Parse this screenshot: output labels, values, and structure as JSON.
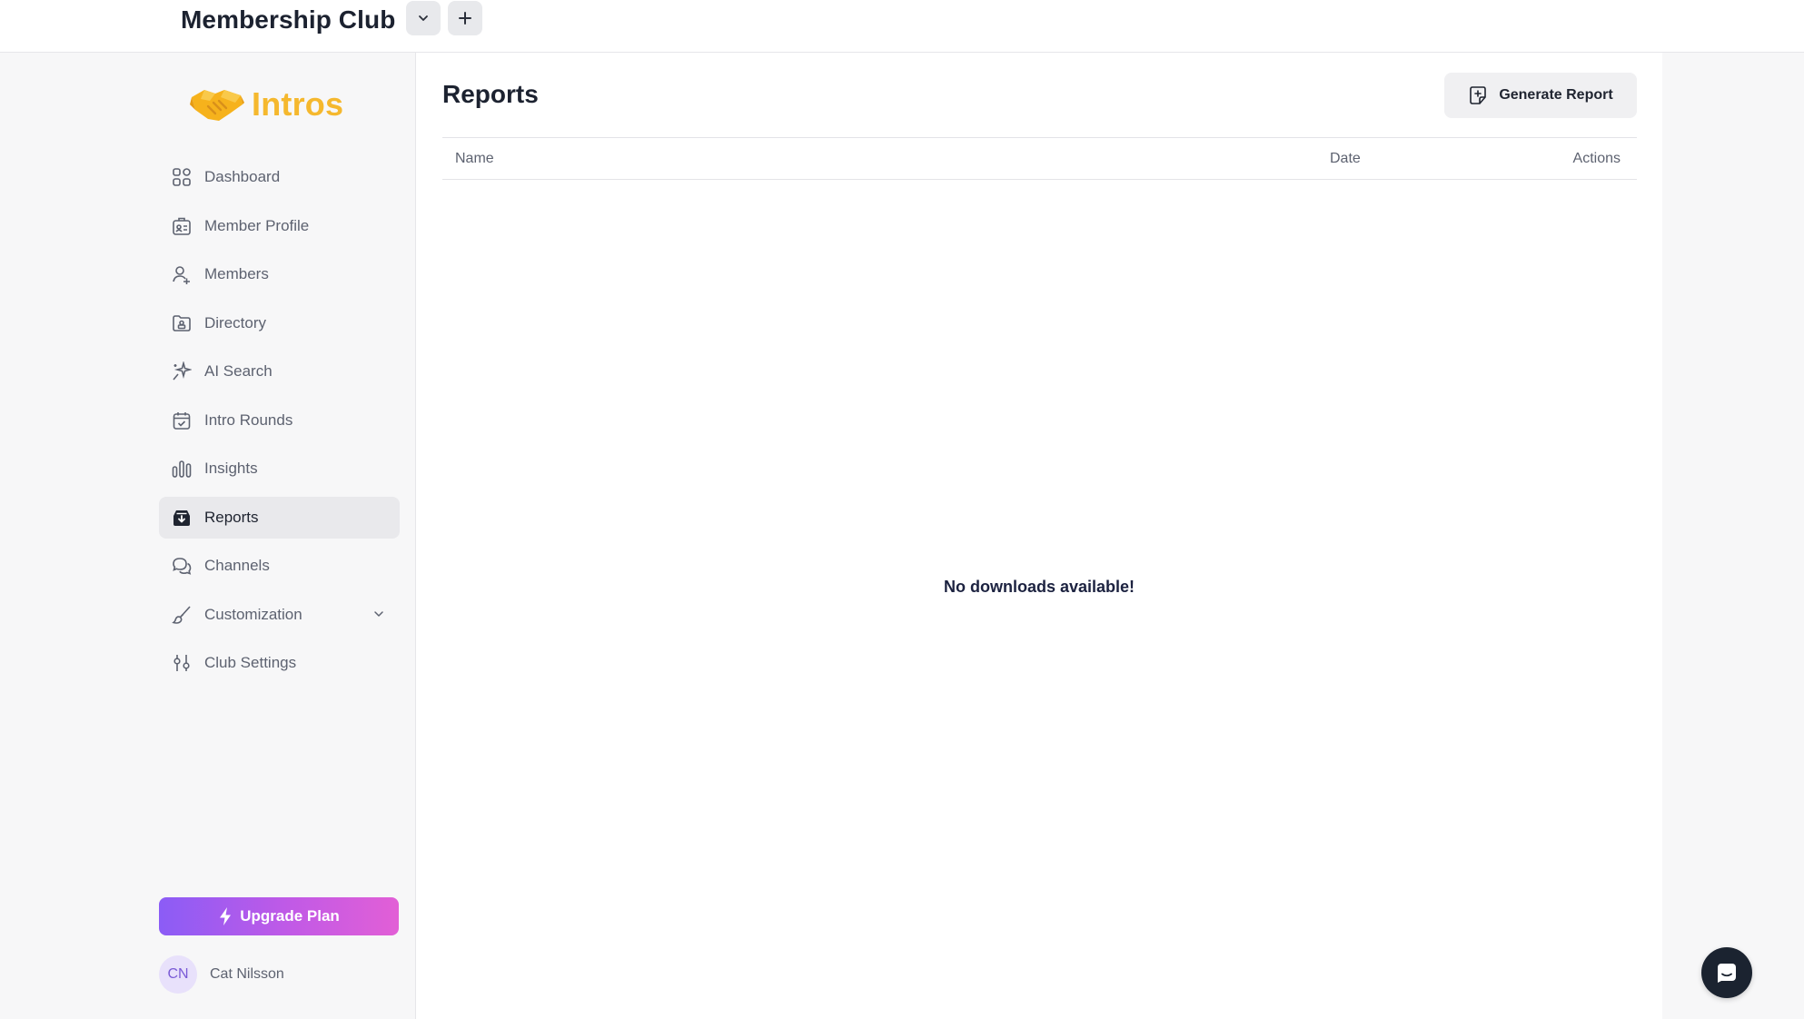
{
  "header": {
    "club_name": "Membership Club",
    "switcher_icon": "chevron-down-icon",
    "add_icon": "plus-icon"
  },
  "sidebar": {
    "logo_text": "Intros",
    "logo_icon": "handshake-icon",
    "logo_color": "#f5b82e",
    "items": [
      {
        "label": "Dashboard",
        "icon": "grid-icon",
        "active": false
      },
      {
        "label": "Member Profile",
        "icon": "id-card-icon",
        "active": false
      },
      {
        "label": "Members",
        "icon": "users-icon",
        "active": false
      },
      {
        "label": "Directory",
        "icon": "folder-user-icon",
        "active": false
      },
      {
        "label": "AI Search",
        "icon": "sparkle-icon",
        "active": false
      },
      {
        "label": "Intro Rounds",
        "icon": "calendar-check-icon",
        "active": false
      },
      {
        "label": "Insights",
        "icon": "bar-chart-icon",
        "active": false
      },
      {
        "label": "Reports",
        "icon": "inbox-download-icon",
        "active": true
      },
      {
        "label": "Channels",
        "icon": "chat-bubbles-icon",
        "active": false
      },
      {
        "label": "Customization",
        "icon": "brush-icon",
        "active": false,
        "expandable": true
      },
      {
        "label": "Club Settings",
        "icon": "sliders-icon",
        "active": false
      }
    ],
    "upgrade_label": "Upgrade Plan",
    "upgrade_icon": "lightning-icon",
    "user": {
      "initials": "CN",
      "name": "Cat Nilsson"
    }
  },
  "main": {
    "title": "Reports",
    "generate_button_label": "Generate Report",
    "generate_button_icon": "document-plus-icon",
    "columns": [
      "Name",
      "Date",
      "Actions"
    ],
    "empty_message": "No downloads available!"
  },
  "chat_widget_icon": "chat-icon",
  "colors": {
    "accent_gradient_start": "#8b5cf6",
    "accent_gradient_end": "#e25fd6",
    "active_nav_bg": "#e9e9ec"
  }
}
